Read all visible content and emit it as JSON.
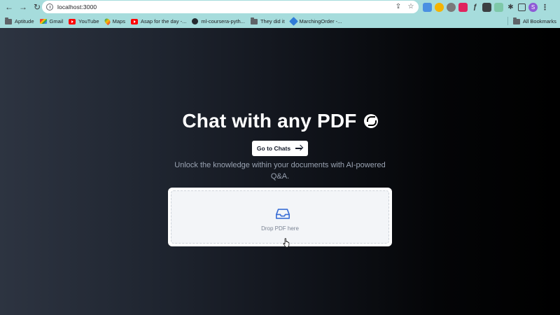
{
  "browser": {
    "url": "localhost:3000",
    "nav": {
      "back": "←",
      "forward": "→",
      "reload": "↻"
    },
    "omnibox_icons": [
      "share-icon",
      "star-icon"
    ],
    "extensions": [
      "ext-icon-1",
      "ext-icon-2",
      "ext-icon-3",
      "ext-icon-4",
      "ext-icon-5",
      "ext-icon-6",
      "ext-icon-7",
      "puzzle-icon",
      "sidepanel-icon"
    ],
    "avatar_letter": "S",
    "menu_icon": "⋮"
  },
  "bookmarks": [
    {
      "label": "Aptitude",
      "icon": "folder"
    },
    {
      "label": "Gmail",
      "icon": "gmail"
    },
    {
      "label": "YouTube",
      "icon": "youtube"
    },
    {
      "label": "Maps",
      "icon": "maps"
    },
    {
      "label": "Asap for the day -...",
      "icon": "youtube"
    },
    {
      "label": "ml-coursera-pyth...",
      "icon": "github"
    },
    {
      "label": "They did it",
      "icon": "folder"
    },
    {
      "label": "MarchingOrder -...",
      "icon": "marchingorder"
    }
  ],
  "all_bookmarks_label": "All Bookmarks",
  "hero": {
    "title": "Chat with any PDF",
    "cta_label": "Go to Chats",
    "subtitle": "Unlock the knowledge within your documents with AI-powered Q&A."
  },
  "dropzone": {
    "label": "Drop PDF here",
    "icon": "inbox-icon",
    "accent": "#3b6fd6"
  }
}
